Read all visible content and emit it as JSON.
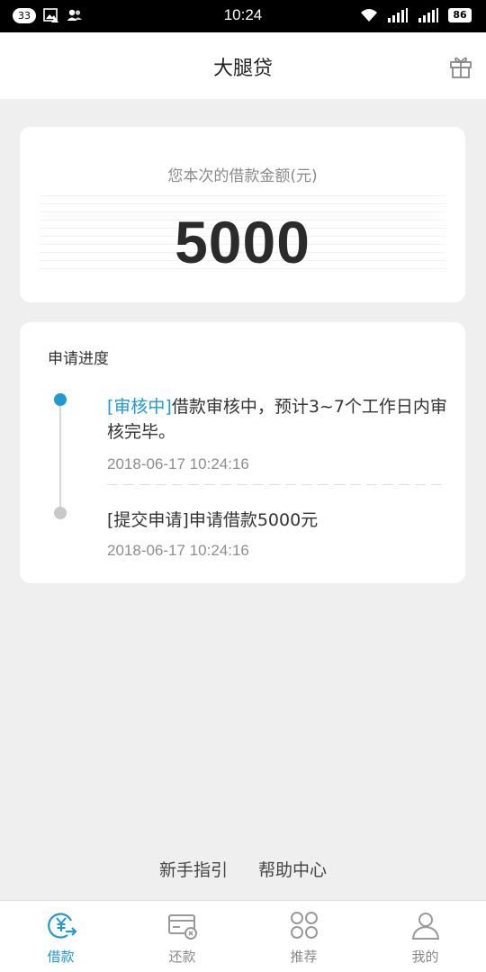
{
  "status_bar": {
    "notifications": "33",
    "time": "10:24",
    "battery": "86"
  },
  "header": {
    "title": "大腿贷",
    "gift_icon": "gift-icon"
  },
  "amount_card": {
    "label": "您本次的借款金额(元)",
    "value": "5000"
  },
  "progress": {
    "title": "申请进度",
    "steps": [
      {
        "tag": "[审核中]",
        "text": "借款审核中，预计3~7个工作日内审核完毕。",
        "time": "2018-06-17 10:24:16",
        "active": true
      },
      {
        "tag": "[提交申请]",
        "text": "申请借款5000元",
        "time": "2018-06-17 10:24:16",
        "active": false
      }
    ]
  },
  "links": {
    "guide": "新手指引",
    "help": "帮助中心"
  },
  "tabs": [
    {
      "label": "借款",
      "icon": "loan-icon",
      "active": true
    },
    {
      "label": "还款",
      "icon": "repay-card-icon",
      "active": false
    },
    {
      "label": "推荐",
      "icon": "grid-icon",
      "active": false
    },
    {
      "label": "我的",
      "icon": "person-icon",
      "active": false
    }
  ],
  "colors": {
    "accent": "#1b9ad6",
    "background": "#efeff0"
  }
}
